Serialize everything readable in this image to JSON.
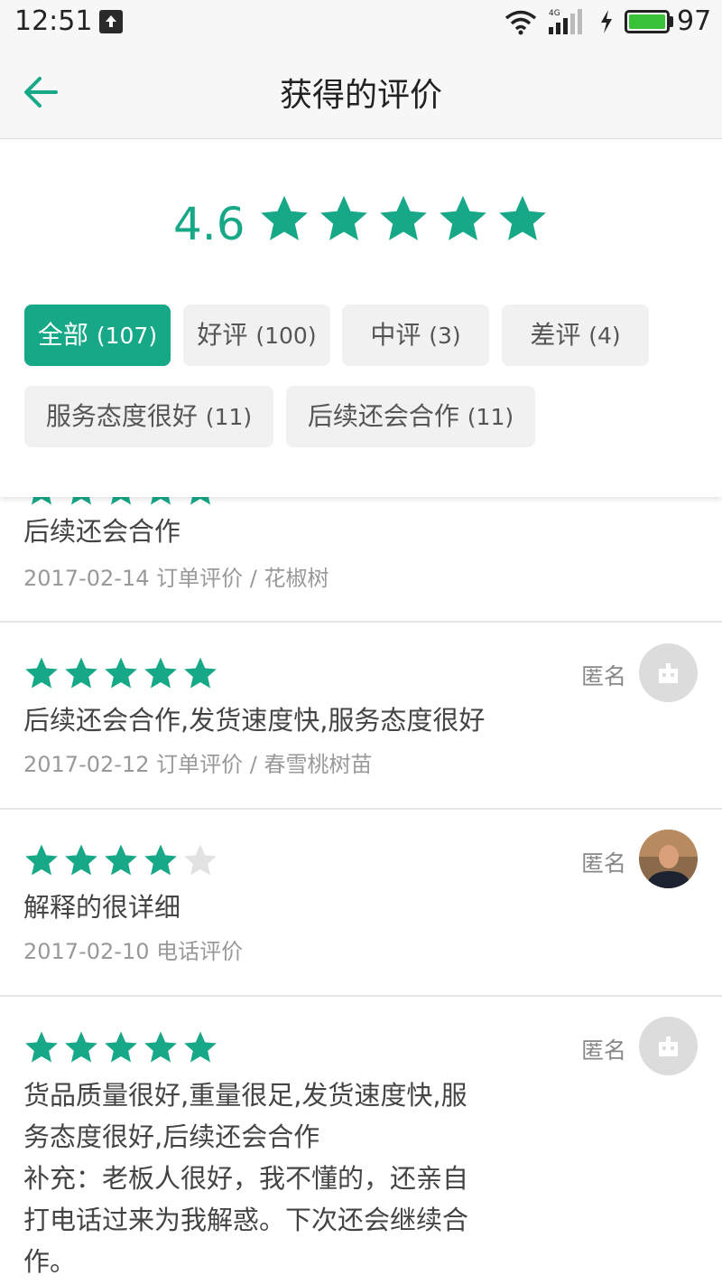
{
  "status_bar": {
    "time": "12:51",
    "network": "4G",
    "battery_level": "97",
    "icons": [
      "upload-icon",
      "wifi-icon",
      "signal-icon",
      "charging-icon",
      "battery-icon"
    ]
  },
  "header": {
    "title": "获得的评价",
    "back_icon": "arrow-left-icon"
  },
  "summary": {
    "score": "4.6",
    "stars": 5
  },
  "filters": [
    {
      "label": "全部",
      "count": "(107)",
      "active": true
    },
    {
      "label": "好评",
      "count": "(100)",
      "active": false
    },
    {
      "label": "中评",
      "count": "(3)",
      "active": false
    },
    {
      "label": "差评",
      "count": "(4)",
      "active": false
    },
    {
      "label": "服务态度很好",
      "count": "(11)",
      "active": false
    },
    {
      "label": "后续还会合作",
      "count": "(11)",
      "active": false
    }
  ],
  "reviews": [
    {
      "rating": 5,
      "text": "后续还会合作",
      "meta": "2017-02-14 订单评价 / 花椒树",
      "author": "",
      "avatar": "default-avatar-icon"
    },
    {
      "rating": 5,
      "text": "后续还会合作,发货速度快,服务态度很好",
      "meta": "2017-02-12 订单评价 / 春雪桃树苗",
      "author": "匿名",
      "avatar": "default-avatar-icon"
    },
    {
      "rating": 4,
      "text": "解释的很详细",
      "meta": "2017-02-10 电话评价",
      "author": "匿名",
      "avatar": "user-photo"
    },
    {
      "rating": 5,
      "text_lines": [
        "货品质量很好,重量很足,发货速度快,服",
        "务态度很好,后续还会合作",
        "补充：老板人很好，我不懂的，还亲自",
        "打电话过来为我解惑。下次还会继续合",
        "作。"
      ],
      "author": "匿名",
      "avatar": "default-avatar-icon"
    }
  ],
  "colors": {
    "accent": "#17a888",
    "star_empty": "#e2e2e2",
    "chip_bg": "#f1f1f1"
  }
}
